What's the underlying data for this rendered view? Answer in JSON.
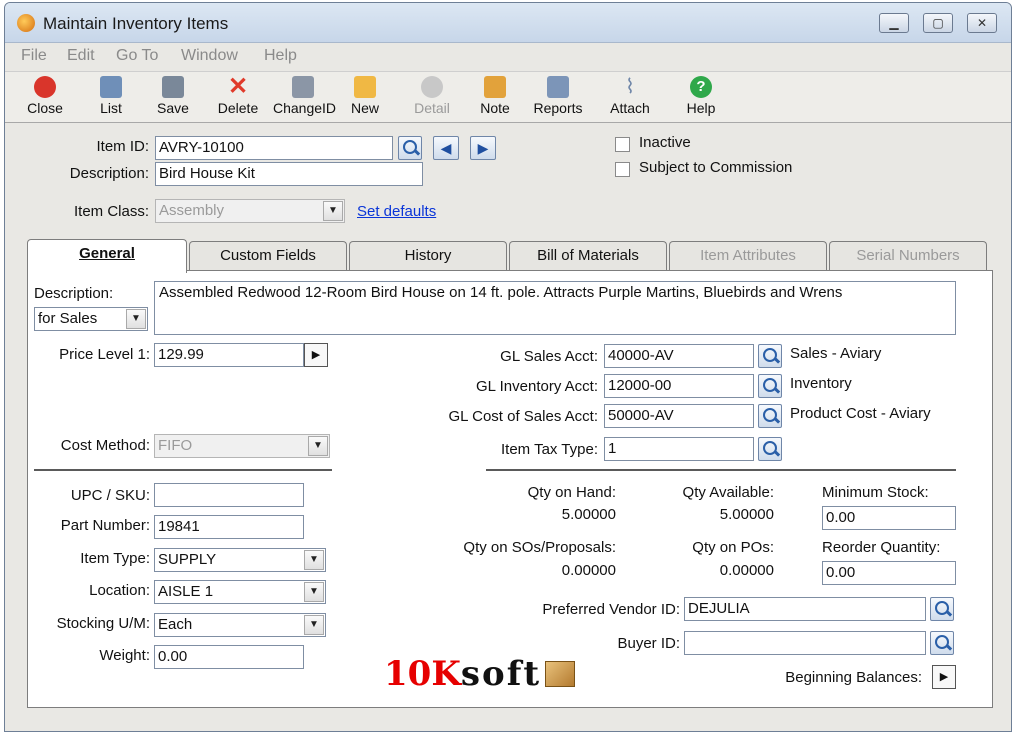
{
  "window": {
    "title": "Maintain Inventory Items"
  },
  "menu": [
    "File",
    "Edit",
    "Go To",
    "Window",
    "Help"
  ],
  "toolbar": [
    {
      "label": "Close",
      "icon": "close-icon",
      "color": "#d9352b",
      "disabled": false
    },
    {
      "label": "List",
      "icon": "list-icon",
      "color": "#6f8fb8",
      "disabled": false
    },
    {
      "label": "Save",
      "icon": "save-icon",
      "color": "#7a8899",
      "disabled": false
    },
    {
      "label": "Delete",
      "icon": "delete-icon",
      "color": "#e03a2a",
      "disabled": false
    },
    {
      "label": "ChangeID",
      "icon": "change-id-icon",
      "color": "#8b96a6",
      "disabled": false
    },
    {
      "label": "New",
      "icon": "new-icon",
      "color": "#f0b844",
      "disabled": false
    },
    {
      "label": "Detail",
      "icon": "detail-icon",
      "color": "#b8b8b8",
      "disabled": true
    },
    {
      "label": "Note",
      "icon": "note-icon",
      "color": "#e2a23b",
      "disabled": false
    },
    {
      "label": "Reports",
      "icon": "reports-icon",
      "color": "#7c95b8",
      "disabled": false
    },
    {
      "label": "Attach",
      "icon": "attach-icon",
      "color": "#8ea3c2",
      "disabled": false
    },
    {
      "label": "Help",
      "icon": "help-icon",
      "color": "#2fa84a",
      "disabled": false
    }
  ],
  "header": {
    "item_id_label": "Item ID:",
    "item_id": "AVRY-10100",
    "description_label": "Description:",
    "description": "Bird House Kit",
    "item_class_label": "Item Class:",
    "item_class": "Assembly",
    "set_defaults": "Set defaults",
    "inactive_label": "Inactive",
    "commission_label": "Subject to Commission"
  },
  "tabs": [
    {
      "label": "General",
      "active": true,
      "disabled": false
    },
    {
      "label": "Custom Fields",
      "active": false,
      "disabled": false
    },
    {
      "label": "History",
      "active": false,
      "disabled": false
    },
    {
      "label": "Bill of Materials",
      "active": false,
      "disabled": false
    },
    {
      "label": "Item Attributes",
      "active": false,
      "disabled": true
    },
    {
      "label": "Serial Numbers",
      "active": false,
      "disabled": true
    }
  ],
  "general": {
    "description_label": "Description:",
    "description_for": "for Sales",
    "long_description": "Assembled Redwood 12-Room Bird House on 14 ft. pole.  Attracts Purple Martins, Bluebirds and Wrens",
    "price_level_label": "Price Level 1:",
    "price_level": "129.99",
    "cost_method_label": "Cost Method:",
    "cost_method": "FIFO",
    "gl_sales_label": "GL Sales Acct:",
    "gl_sales": "40000-AV",
    "gl_sales_desc": "Sales - Aviary",
    "gl_inventory_label": "GL Inventory Acct:",
    "gl_inventory": "12000-00",
    "gl_inventory_desc": "Inventory",
    "gl_cost_label": "GL Cost of Sales Acct:",
    "gl_cost": "50000-AV",
    "gl_cost_desc": "Product Cost - Aviary",
    "tax_type_label": "Item Tax Type:",
    "tax_type": "1",
    "upc_label": "UPC / SKU:",
    "upc": "",
    "part_number_label": "Part Number:",
    "part_number": "19841",
    "item_type_label": "Item Type:",
    "item_type": "SUPPLY",
    "location_label": "Location:",
    "location": "AISLE 1",
    "stocking_um_label": "Stocking U/M:",
    "stocking_um": "Each",
    "weight_label": "Weight:",
    "weight": "0.00",
    "qty_on_hand_label": "Qty on Hand:",
    "qty_on_hand": "5.00000",
    "qty_available_label": "Qty Available:",
    "qty_available": "5.00000",
    "min_stock_label": "Minimum Stock:",
    "min_stock": "0.00",
    "qty_sos_label": "Qty on SOs/Proposals:",
    "qty_sos": "0.00000",
    "qty_pos_label": "Qty on POs:",
    "qty_pos": "0.00000",
    "reorder_label": "Reorder Quantity:",
    "reorder": "0.00",
    "vendor_label": "Preferred Vendor ID:",
    "vendor": "DEJULIA",
    "buyer_label": "Buyer ID:",
    "buyer": "",
    "beginning_balances_label": "Beginning Balances:"
  },
  "watermark": {
    "part1": "10K",
    "part2": "soft"
  }
}
